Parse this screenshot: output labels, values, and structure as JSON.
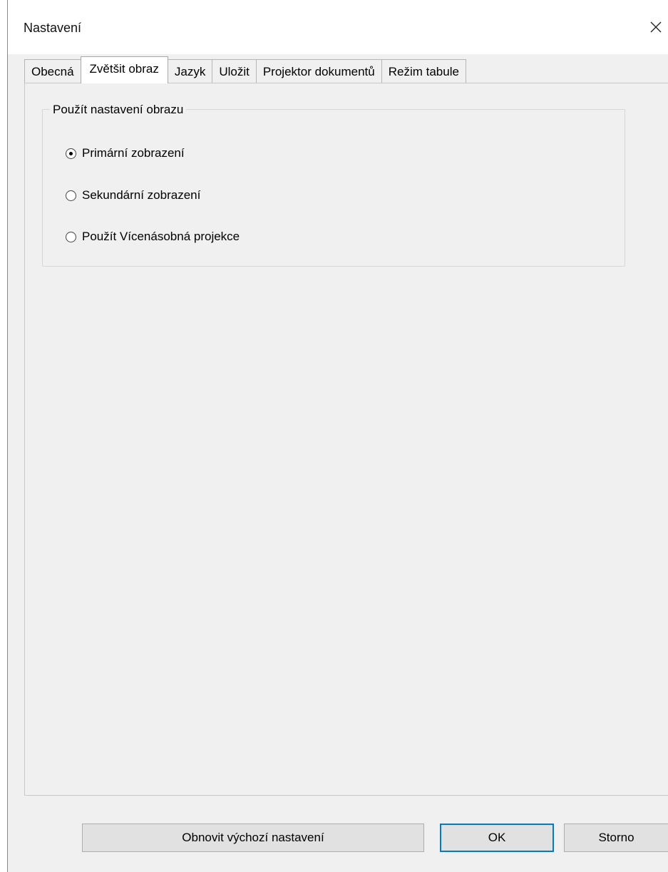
{
  "window": {
    "title": "Nastavení"
  },
  "tabs": [
    {
      "label": "Obecná",
      "active": false
    },
    {
      "label": "Zvětšit obraz",
      "active": true
    },
    {
      "label": "Jazyk",
      "active": false
    },
    {
      "label": "Uložit",
      "active": false
    },
    {
      "label": "Projektor dokumentů",
      "active": false
    },
    {
      "label": "Režim tabule",
      "active": false
    }
  ],
  "group": {
    "title": "Použít nastavení obrazu",
    "options": [
      {
        "label": "Primární zobrazení",
        "selected": true
      },
      {
        "label": "Sekundární zobrazení",
        "selected": false
      },
      {
        "label": "Použít Vícenásobná projekce",
        "selected": false
      }
    ]
  },
  "buttons": {
    "reset": "Obnovit výchozí nastavení",
    "ok": "OK",
    "cancel": "Storno"
  },
  "colors": {
    "focus_border": "#0078d7",
    "panel_bg": "#f0f0f0"
  }
}
